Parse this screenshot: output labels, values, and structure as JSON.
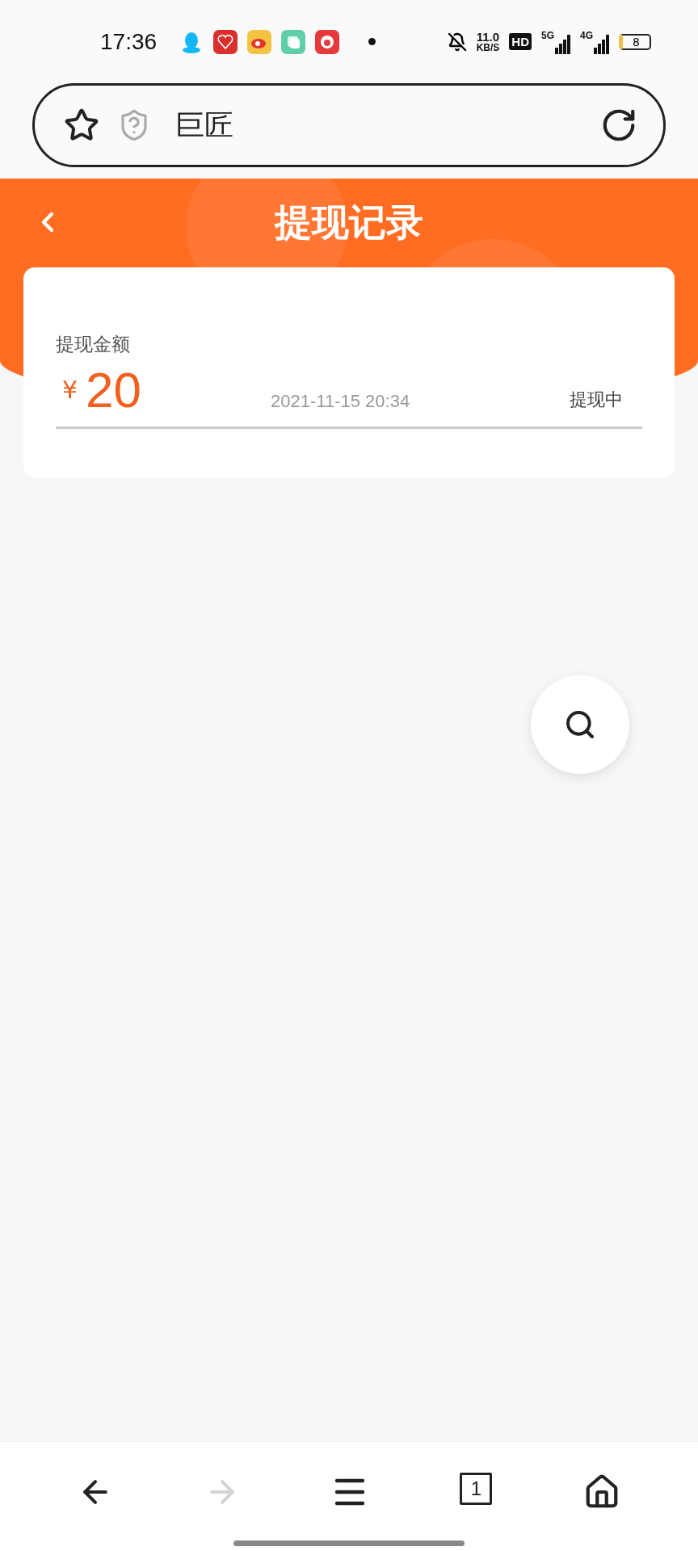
{
  "status_bar": {
    "time": "17:36",
    "net_speed": "11.0",
    "net_unit": "KB/S",
    "hd_badge": "HD",
    "signals": [
      "5G",
      "4G"
    ],
    "battery": "8"
  },
  "address_bar": {
    "title": "巨匠"
  },
  "header": {
    "title": "提现记录"
  },
  "records": [
    {
      "label": "提现金额",
      "currency": "¥",
      "amount": "20",
      "date": "2021-11-15 20:34",
      "status": "提现中"
    }
  ],
  "bottom_bar": {
    "buttons": [
      {
        "kind": "back",
        "disabled": false
      },
      {
        "kind": "forward",
        "disabled": true
      },
      {
        "kind": "menu",
        "disabled": false
      },
      {
        "kind": "tabs",
        "disabled": false,
        "count": "1"
      },
      {
        "kind": "home",
        "disabled": false
      }
    ]
  }
}
